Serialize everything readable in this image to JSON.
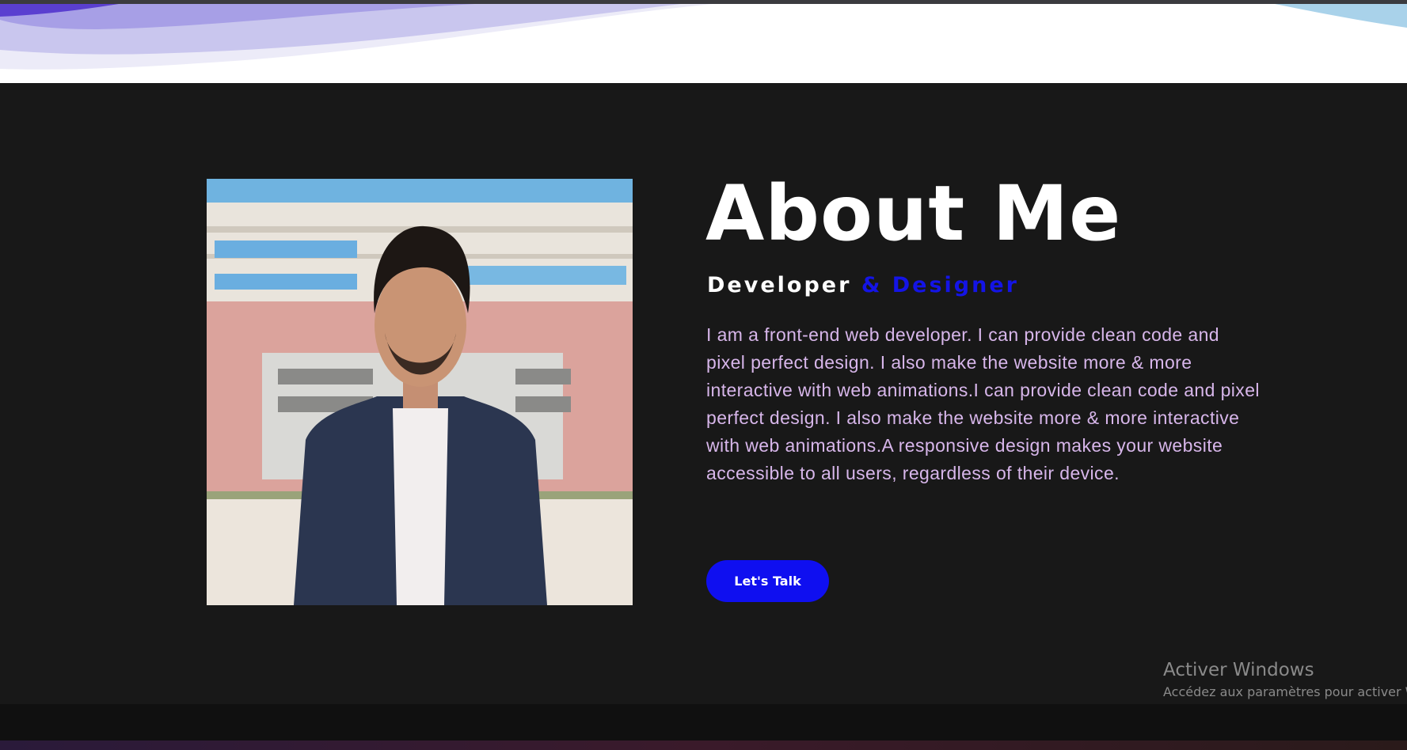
{
  "about": {
    "title": "About Me",
    "role_primary": "Developer",
    "role_secondary": "& Designer",
    "bio": "I am a front-end web developer. I can provide clean code and pixel perfect design. I also make the website more & more interactive with web animations.I can provide clean code and pixel perfect design. I also make the website more & more interactive with web animations.A responsive design makes your website accessible to all users, regardless of their device.",
    "cta_label": "Let's Talk"
  },
  "watermark": {
    "title": "Activer Windows",
    "subtitle": "Accédez aux paramètres pour activer W"
  },
  "colors": {
    "background": "#181818",
    "accent": "#0f0ff0",
    "bio_text": "#d7b6ea",
    "wave_purple": "#5a3fd0"
  },
  "icons": {
    "portrait": "person-portrait-photo"
  }
}
